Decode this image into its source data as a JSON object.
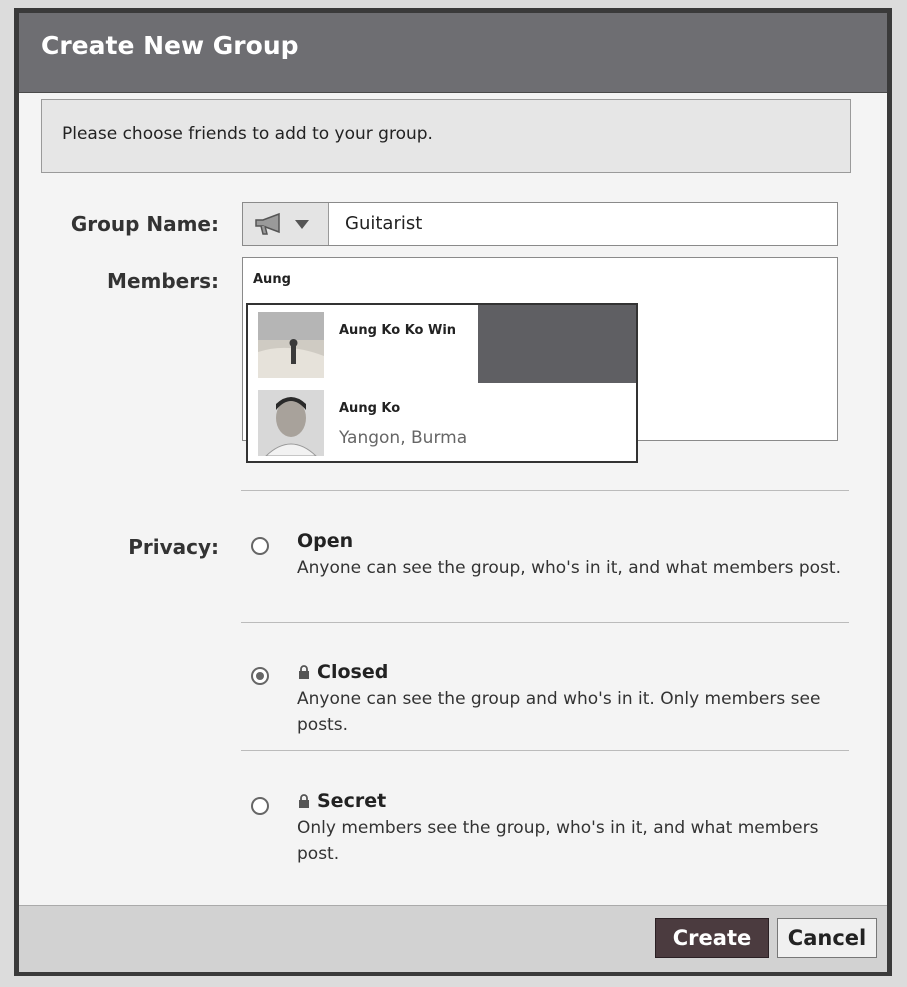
{
  "dialog": {
    "title": "Create New Group",
    "info_text": "Please choose friends to add to your group."
  },
  "form": {
    "group_name_label": "Group Name:",
    "group_name_value": "Guitarist",
    "group_icon": "megaphone-icon",
    "members_label": "Members:",
    "members_typed": "Aung",
    "privacy_label": "Privacy:"
  },
  "suggestions": [
    {
      "name": "Aung Ko Ko Win",
      "subtitle": ""
    },
    {
      "name": "Aung Ko",
      "subtitle": "Yangon, Burma"
    }
  ],
  "privacy": {
    "selected": "closed",
    "options": [
      {
        "id": "open",
        "title": "Open",
        "locked": false,
        "desc": "Anyone can see the group, who's in it, and what members post."
      },
      {
        "id": "closed",
        "title": "Closed",
        "locked": true,
        "desc": "Anyone can see the group and who's in it. Only members see posts."
      },
      {
        "id": "secret",
        "title": "Secret",
        "locked": true,
        "desc": "Only members see the group, who's in it, and what members post."
      }
    ]
  },
  "buttons": {
    "create": "Create",
    "cancel": "Cancel"
  },
  "colors": {
    "titlebar": "#6e6e72",
    "primary_button": "#4b3b3f",
    "highlight": "#5f5f63"
  }
}
